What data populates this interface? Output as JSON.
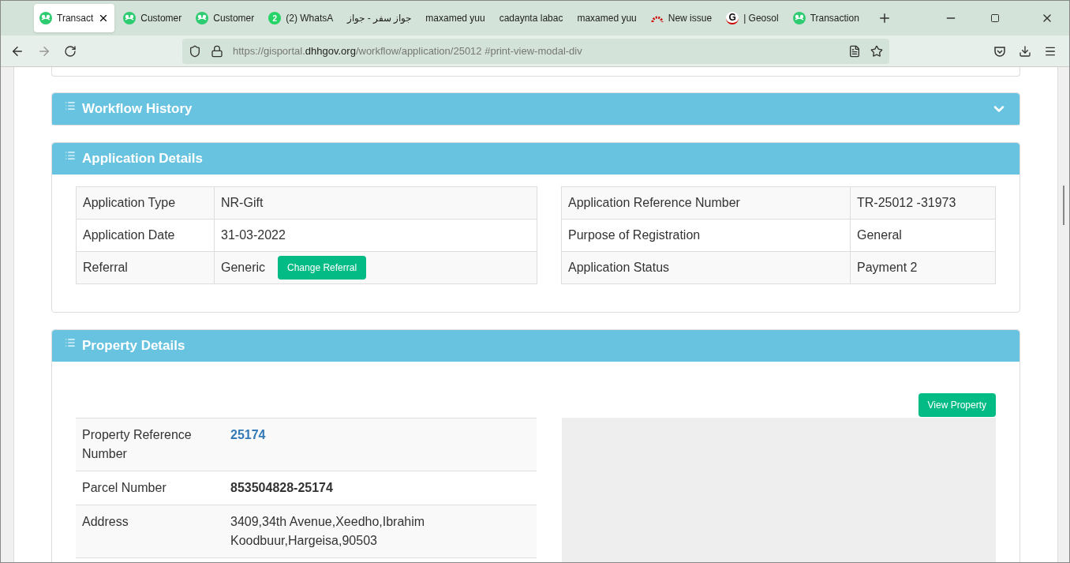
{
  "browser": {
    "tabs": [
      {
        "title": "Transact",
        "kind": "app",
        "selected": true
      },
      {
        "title": "Customer",
        "kind": "app",
        "selected": false
      },
      {
        "title": "Customer",
        "kind": "app",
        "selected": false
      },
      {
        "title": "(2) WhatsA",
        "kind": "chat",
        "badge": "2",
        "selected": false
      },
      {
        "title": "جواز سفر - جواز",
        "kind": "plain",
        "selected": false
      },
      {
        "title": "maxamed yuu",
        "kind": "plain",
        "selected": false
      },
      {
        "title": "cadaynta labac",
        "kind": "plain",
        "selected": false
      },
      {
        "title": "maxamed yuu",
        "kind": "plain",
        "selected": false
      },
      {
        "title": "New issue",
        "kind": "gauge",
        "selected": false
      },
      {
        "title": "| Geosol",
        "kind": "letter",
        "badge": "G",
        "selected": false
      },
      {
        "title": "Transaction",
        "kind": "app",
        "selected": false
      }
    ],
    "url": {
      "prefix": "https://gisportal.",
      "host": "dhhgov.org",
      "path": "/workflow/application/25012 #print-view-modal-div"
    }
  },
  "panels": [
    {
      "title": "Workflow History",
      "kind": "collapsible"
    },
    {
      "title": "Application Details",
      "kind": "section",
      "left_table": [
        {
          "label": "Application Type",
          "value": "NR-Gift"
        },
        {
          "label": "Application Date",
          "value": "31-03-2022"
        },
        {
          "label": "Referral",
          "value": "Generic",
          "button": "Change Referral"
        }
      ],
      "right_table": [
        {
          "label": "Application Reference Number",
          "value": "TR-25012 -31973"
        },
        {
          "label": "Purpose of Registration",
          "value": "General"
        },
        {
          "label": "Application Status",
          "value": "Payment 2"
        }
      ]
    },
    {
      "title": "Property Details",
      "kind": "section",
      "button": "View Property",
      "rows": [
        {
          "label": "Property Reference Number",
          "value": "25174",
          "kind": "link"
        },
        {
          "label": "Parcel Number",
          "value": "853504828-25174",
          "kind": "bold"
        },
        {
          "label": "Address",
          "value": "3409,34th Avenue,Xeedho,Ibrahim Koodbuur,Hargeisa,90503",
          "kind": "plain"
        }
      ]
    }
  ]
}
